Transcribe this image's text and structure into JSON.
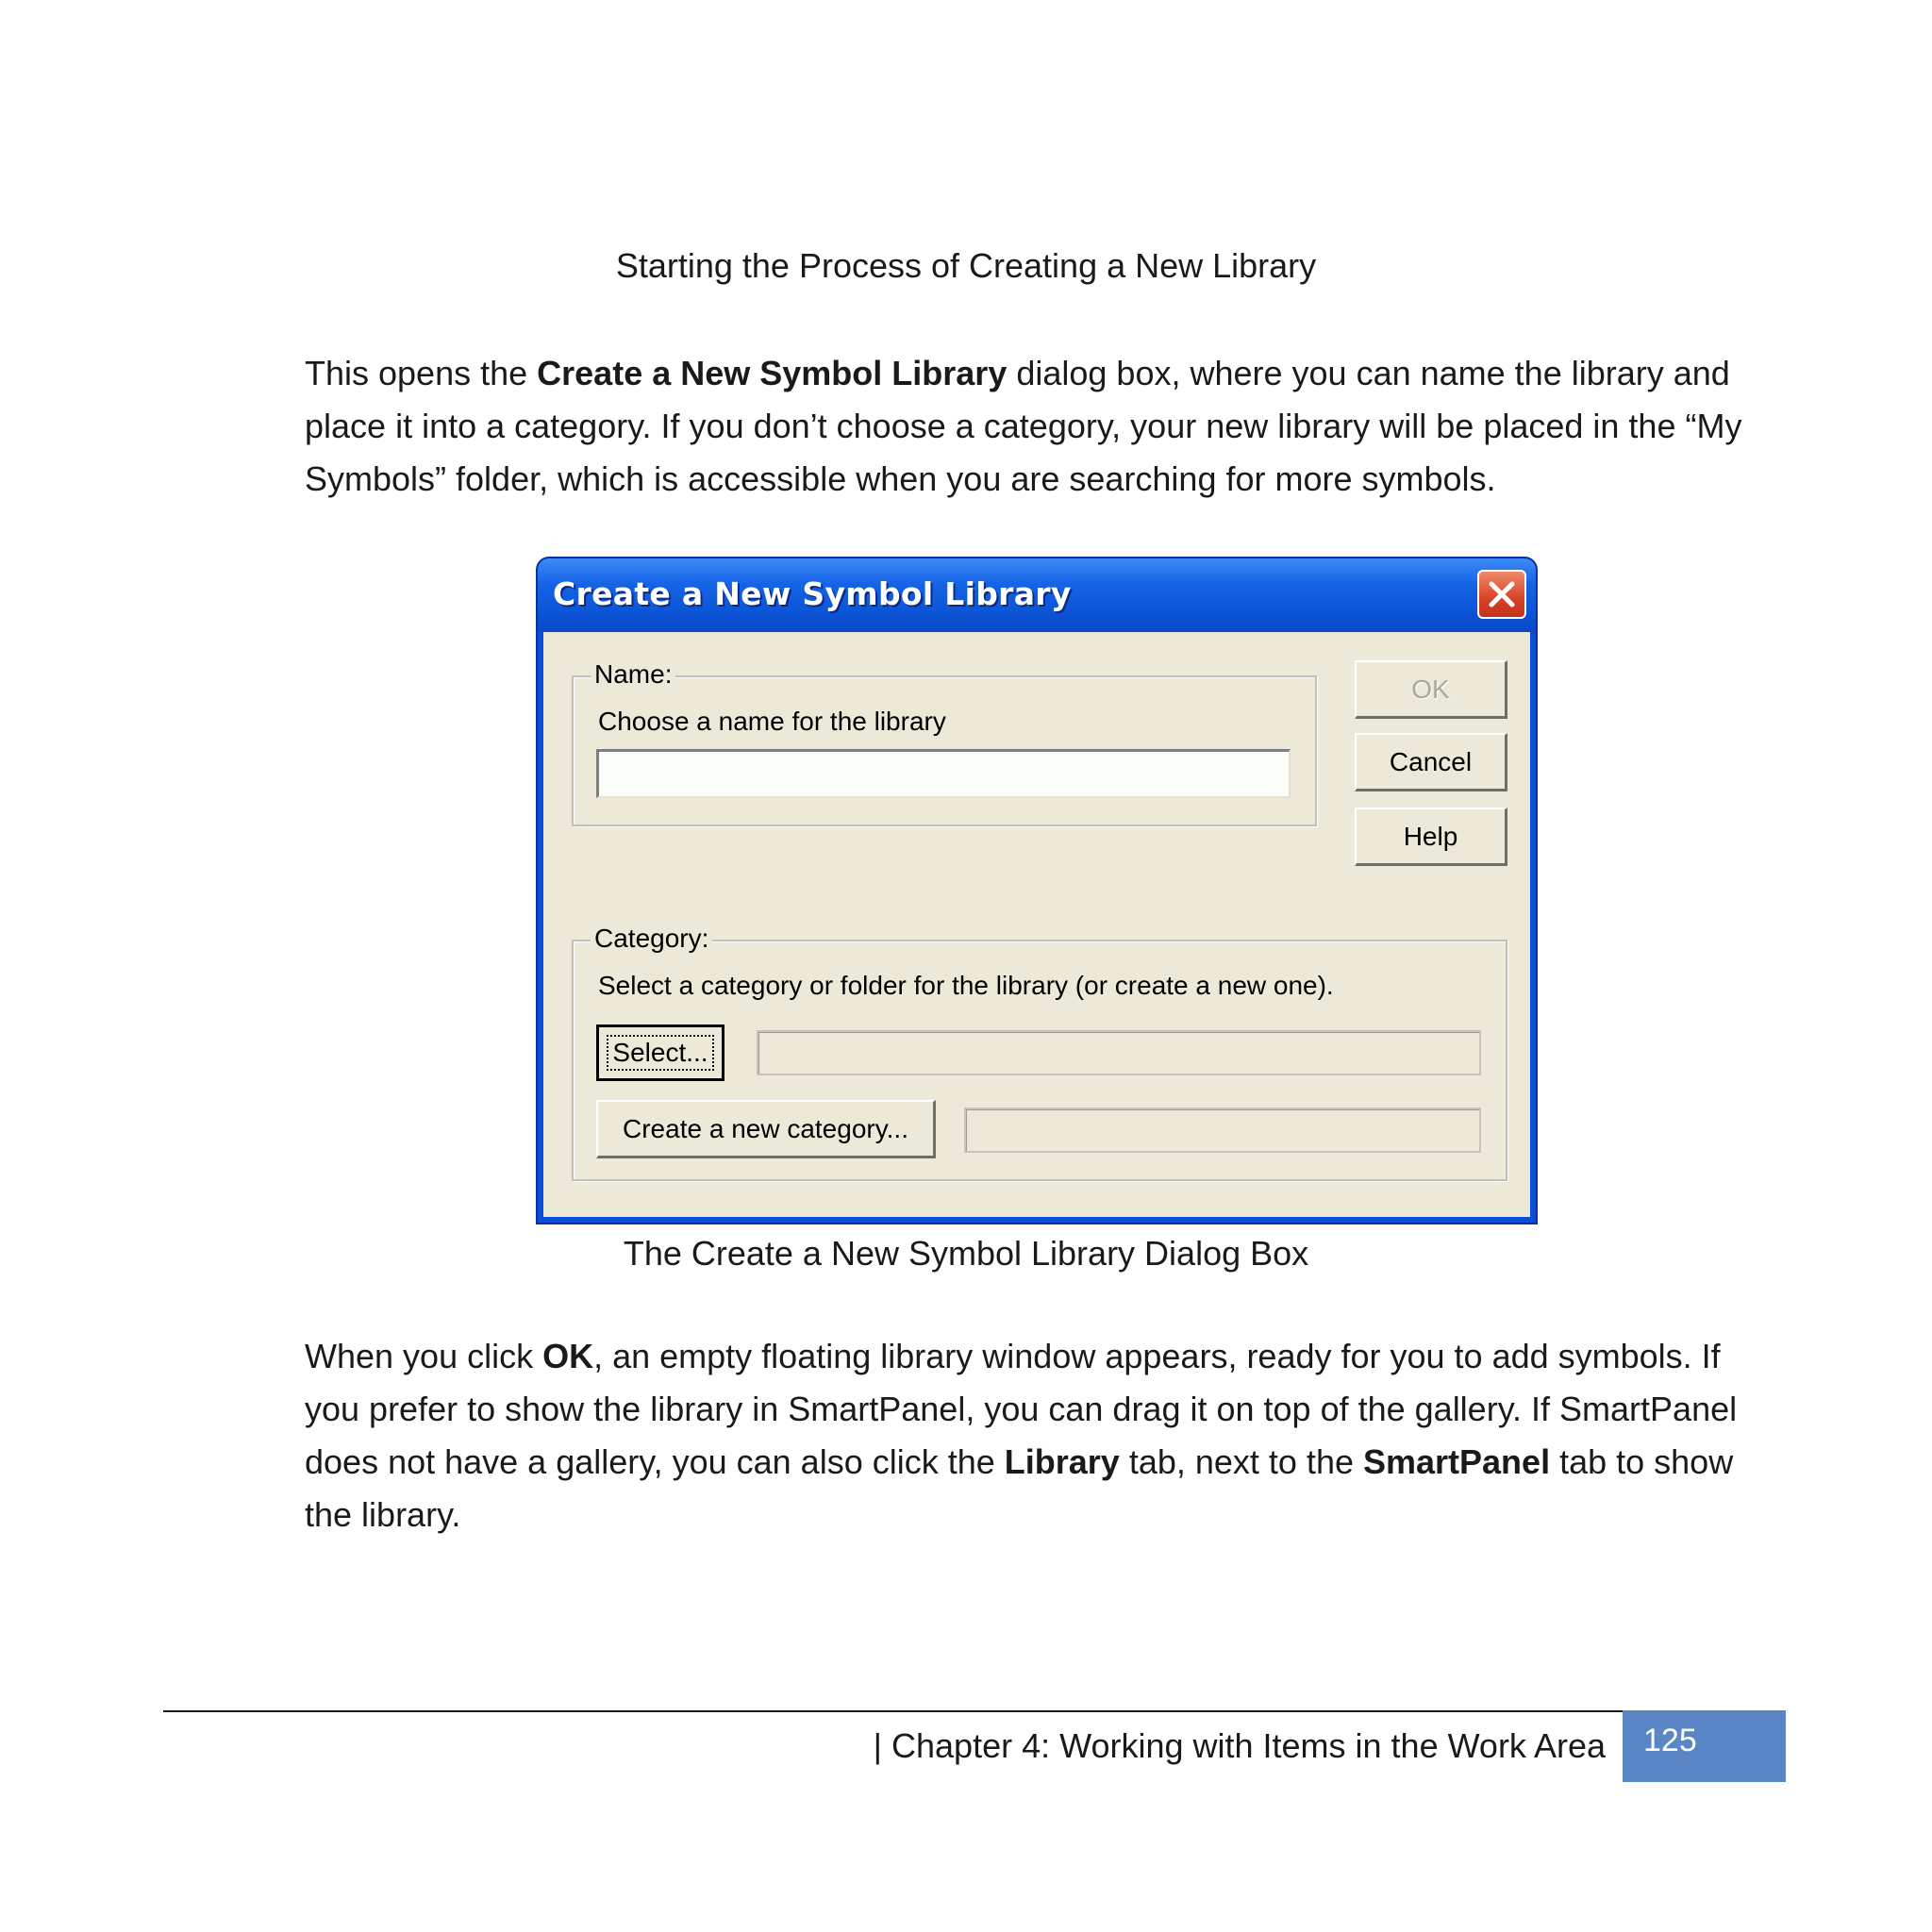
{
  "figure_title": "Starting the Process of Creating a New Library",
  "paragraph1": {
    "t1": "This opens the ",
    "b1": "Create a New Symbol Library",
    "t2": " dialog box, where you can name the library and place it into a category.  If you don’t choose a category, your new library will be placed in the “My Symbols” folder, which is accessible when you are searching for more symbols."
  },
  "dialog": {
    "title": "Create a New Symbol Library",
    "close_icon": "close-icon",
    "name_group": {
      "legend": "Name:",
      "instruction": "Choose a name for the library",
      "value": ""
    },
    "buttons": {
      "ok": "OK",
      "cancel": "Cancel",
      "help": "Help"
    },
    "category_group": {
      "legend": "Category:",
      "instruction": "Select a category or folder for the library (or create a new one).",
      "select_button": "Select...",
      "select_value": "",
      "create_button": "Create a new category...",
      "create_value": ""
    }
  },
  "figure_caption": "The Create a New Symbol Library Dialog Box",
  "paragraph2": {
    "t1": "When you click ",
    "b1": "OK",
    "t2": ", an empty floating library window appears, ready for you to add symbols.  If you prefer to show the library in SmartPanel, you can drag it on top of the gallery.  If SmartPanel does not have a gallery, you can also click the ",
    "b2": "Library",
    "t3": " tab, next to the ",
    "b3": "SmartPanel",
    "t4": " tab to show the library."
  },
  "footer": {
    "chapter": "| Chapter 4: Working with Items in the Work Area",
    "page": "125",
    "accent_color": "#5a86c5"
  }
}
